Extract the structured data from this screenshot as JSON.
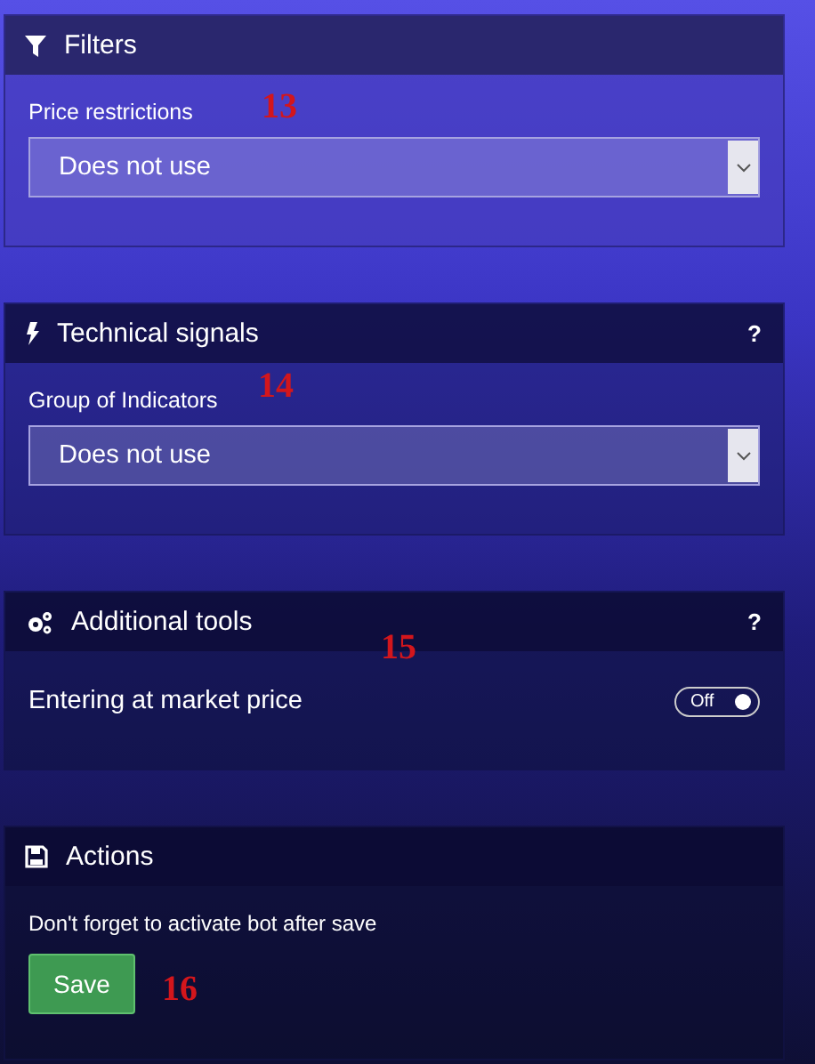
{
  "panels": [
    {
      "title": "Filters",
      "kind": "select",
      "label": "Price restrictions",
      "value": "Does not use",
      "marker": "13"
    },
    {
      "title": "Technical signals",
      "help_text": "?",
      "kind": "select",
      "label": "Group of Indicators",
      "value": "Does not use",
      "marker": "14"
    },
    {
      "title": "Additional tools",
      "help_text": "?",
      "kind": "toggle",
      "label": "Entering at market price",
      "toggle_text": "Off",
      "on": false,
      "marker": "15"
    },
    {
      "title": "Actions",
      "kind": "action",
      "note": "Don't forget to activate bot after save",
      "button": "Save",
      "marker": "16"
    }
  ]
}
